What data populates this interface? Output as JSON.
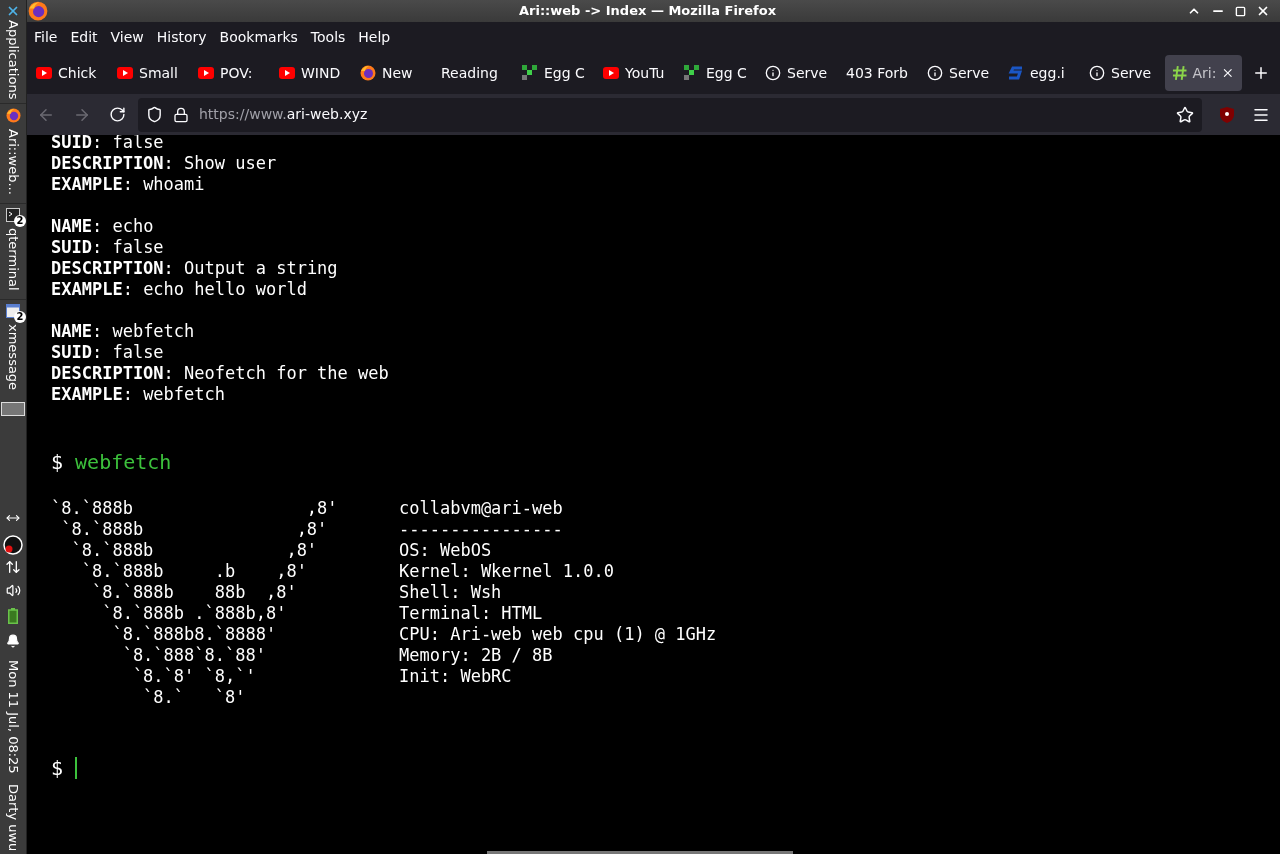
{
  "window": {
    "title": "Ari::web -> Index — Mozilla Firefox"
  },
  "panel": {
    "launcher": "Applications",
    "tasks": [
      {
        "label": "Ari::web...",
        "kind": "firefox"
      },
      {
        "label": "qterminal",
        "kind": "terminal",
        "badge": "2"
      },
      {
        "label": "xmessage",
        "kind": "message",
        "badge": "2"
      }
    ],
    "clock": "Mon 11 Jul, 08:25",
    "user": "Darty uwu"
  },
  "menu": [
    "File",
    "Edit",
    "View",
    "History",
    "Bookmarks",
    "Tools",
    "Help"
  ],
  "tabs": [
    {
      "label": "Chick",
      "kind": "youtube",
      "selected": false
    },
    {
      "label": "Small",
      "kind": "youtube",
      "selected": false
    },
    {
      "label": "POV:",
      "kind": "youtube",
      "selected": false
    },
    {
      "label": "WIND",
      "kind": "youtube",
      "selected": false
    },
    {
      "label": "New",
      "kind": "firefox",
      "selected": false
    },
    {
      "label": "Reading",
      "kind": "plain",
      "selected": false
    },
    {
      "label": "Egg C",
      "kind": "egg",
      "selected": false
    },
    {
      "label": "YouTu",
      "kind": "youtube",
      "selected": false
    },
    {
      "label": "Egg C",
      "kind": "egg",
      "selected": false
    },
    {
      "label": "Serve",
      "kind": "info",
      "selected": false
    },
    {
      "label": "403 Forb",
      "kind": "plain",
      "selected": false
    },
    {
      "label": "Serve",
      "kind": "info",
      "selected": false
    },
    {
      "label": "egg.i",
      "kind": "s",
      "selected": false
    },
    {
      "label": "Serve",
      "kind": "info",
      "selected": false
    },
    {
      "label": "Ari:",
      "kind": "hash",
      "selected": true
    }
  ],
  "navigation": {
    "back_disabled": true,
    "forward_disabled": true,
    "url_dim": "https://www.",
    "url_main": "ari-web.xyz"
  },
  "terminal": {
    "entries": [
      {
        "lines": [
          "**SUID**: false",
          "**DESCRIPTION**: Show user",
          "**EXAMPLE**: whoami"
        ]
      },
      {
        "lines": [
          "**NAME**: echo",
          "**SUID**: false",
          "**DESCRIPTION**: Output a string",
          "**EXAMPLE**: echo hello world"
        ]
      },
      {
        "lines": [
          "**NAME**: webfetch",
          "**SUID**: false",
          "**DESCRIPTION**: Neofetch for the web",
          "**EXAMPLE**: webfetch"
        ]
      }
    ],
    "command": {
      "prompt": "$",
      "text": "webfetch"
    },
    "art_lines": [
      "`8.`888b                 ,8'",
      " `8.`888b               ,8'",
      "  `8.`888b             ,8'",
      "   `8.`888b     .b    ,8'",
      "    `8.`888b    88b  ,8'",
      "     `8.`888b .`888b,8'",
      "      `8.`888b8.`8888'",
      "       `8.`888`8.`88'",
      "        `8.`8' `8,`'",
      "         `8.`   `8'"
    ],
    "info_lines": [
      "collabvm@ari-web",
      "----------------",
      "OS: WebOS",
      "Kernel: Wkernel 1.0.0",
      "Shell: Wsh",
      "Terminal: HTML",
      "CPU: Ari-web web cpu (1) @ 1GHz",
      "Memory: 2B / 8B",
      "Init: WebRC"
    ],
    "input": {
      "prompt": "$"
    }
  }
}
